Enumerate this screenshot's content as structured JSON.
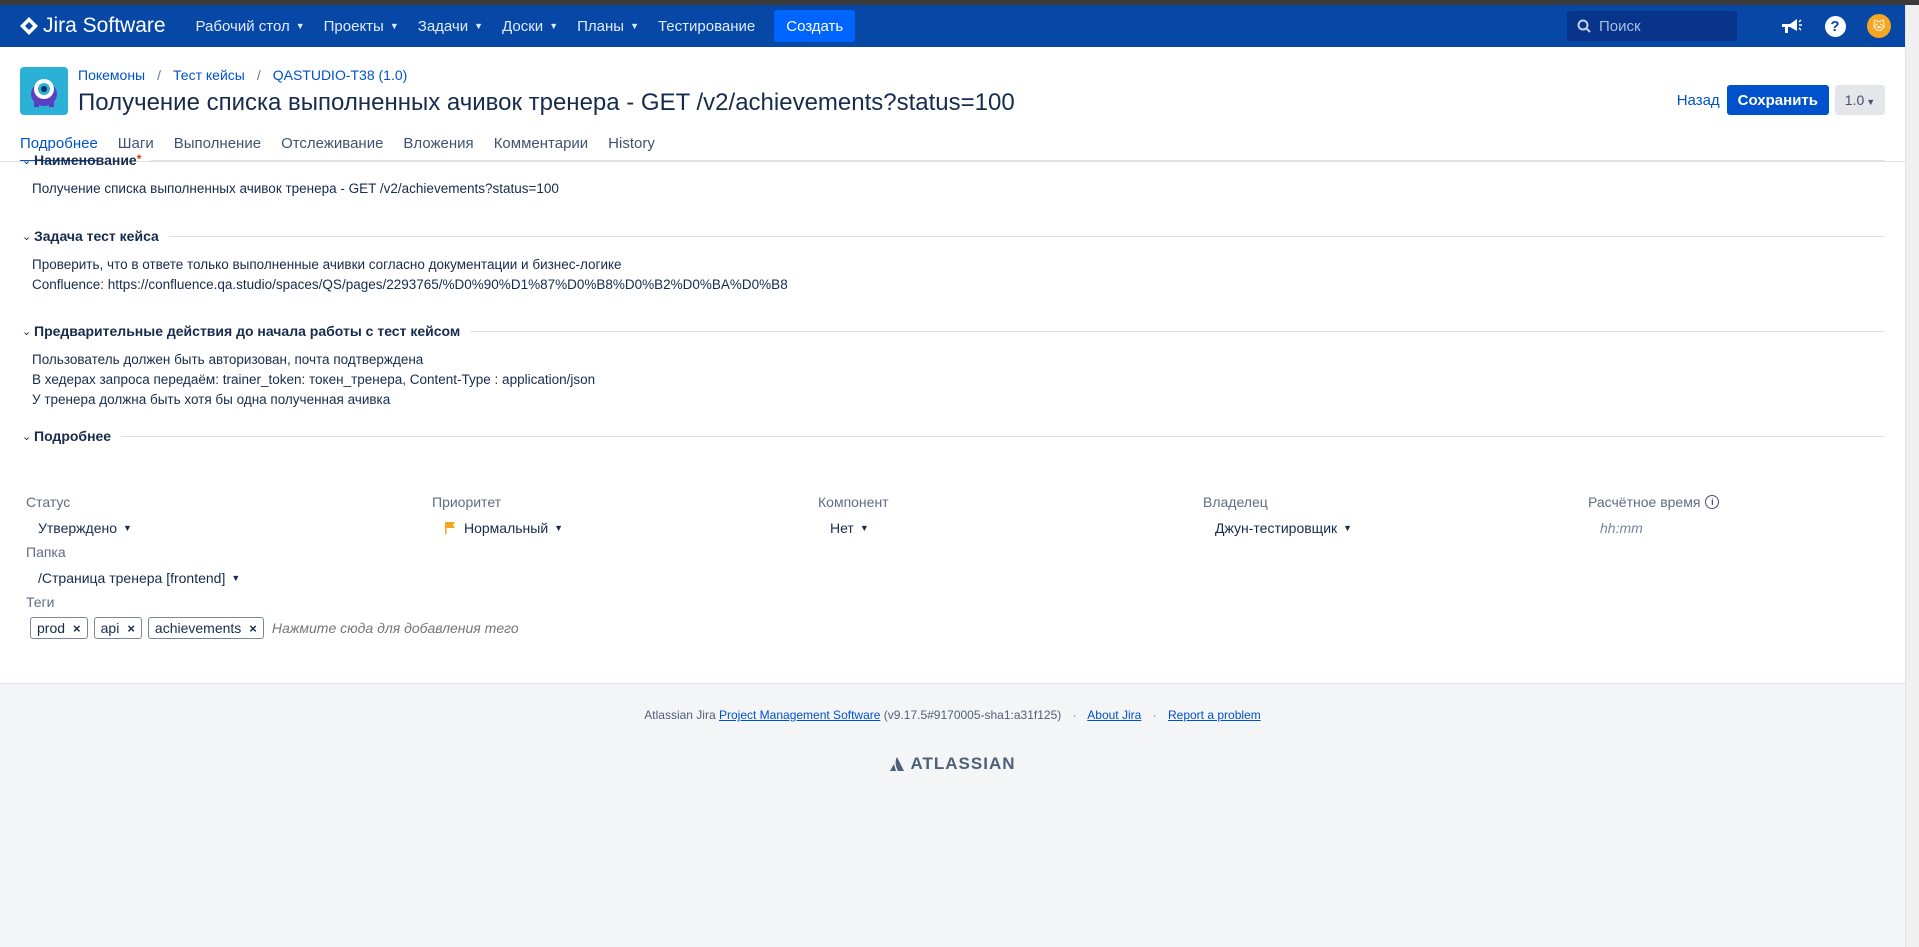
{
  "nav": {
    "product": "Jira Software",
    "items": [
      {
        "label": "Рабочий стол",
        "dropdown": true
      },
      {
        "label": "Проекты",
        "dropdown": true
      },
      {
        "label": "Задачи",
        "dropdown": true
      },
      {
        "label": "Доски",
        "dropdown": true
      },
      {
        "label": "Планы",
        "dropdown": true
      },
      {
        "label": "Тестирование",
        "dropdown": false
      }
    ],
    "create_label": "Создать",
    "search_placeholder": "Поиск",
    "icons": [
      "notifications-megaphone-icon",
      "help-icon",
      "user-avatar"
    ]
  },
  "header": {
    "breadcrumb": [
      "Покемоны",
      "Тест кейсы",
      "QASTUDIO-T38 (1.0)"
    ],
    "title": "Получение списка выполненных ачивок тренера - GET /v2/achievements?status=100",
    "back_label": "Назад",
    "save_label": "Сохранить",
    "version_label": "1.0"
  },
  "tabs": [
    "Подробнее",
    "Шаги",
    "Выполнение",
    "Отслеживание",
    "Вложения",
    "Комментарии",
    "History"
  ],
  "active_tab": "Подробнее",
  "sections": {
    "name": {
      "title": "Наименование",
      "required_mark": "*",
      "lines": [
        "Получение списка выполненных ачивок тренера - GET /v2/achievements?status=100"
      ]
    },
    "objective": {
      "title": "Задача тест кейса",
      "lines": [
        "Проверить, что в ответе только выполненные ачивки согласно документации и бизнес-логике",
        "Confluence: https://confluence.qa.studio/spaces/QS/pages/2293765/%D0%90%D1%87%D0%B8%D0%B2%D0%BA%D0%B8"
      ]
    },
    "precondition": {
      "title": "Предварительные действия до начала работы с тест кейсом",
      "lines": [
        "Пользователь должен быть авторизован, почта подтверждена",
        "В хедерах запроса передаём: trainer_token: токен_тренера, Content-Type : application/json",
        "У тренера должна быть хотя бы одна полученная ачивка"
      ]
    },
    "details": {
      "title": "Подробнее",
      "status": {
        "label": "Статус",
        "value": "Утверждено"
      },
      "priority": {
        "label": "Приоритет",
        "value": "Нормальный",
        "color": "#f5a623"
      },
      "component": {
        "label": "Компонент",
        "value": "Нет"
      },
      "owner": {
        "label": "Владелец",
        "value": "Джун-тестировщик"
      },
      "estimate": {
        "label": "Расчётное время",
        "placeholder": "hh:mm"
      },
      "folder": {
        "label": "Папка",
        "value": "/Страница тренера [frontend]"
      },
      "tags": {
        "label": "Теги",
        "items": [
          "prod",
          "api",
          "achievements"
        ],
        "placeholder": "Нажмите сюда для добавления тего"
      }
    }
  },
  "footer": {
    "prefix": "Atlassian Jira",
    "link_pms": "Project Management Software",
    "version": "(v9.17.5#9170005-sha1:a31f125)",
    "about": "About Jira",
    "report": "Report a problem",
    "brand": "ATLASSIAN"
  },
  "colors": {
    "nav_bg": "#0747a6",
    "primary": "#0052cc",
    "create": "#0065ff"
  }
}
